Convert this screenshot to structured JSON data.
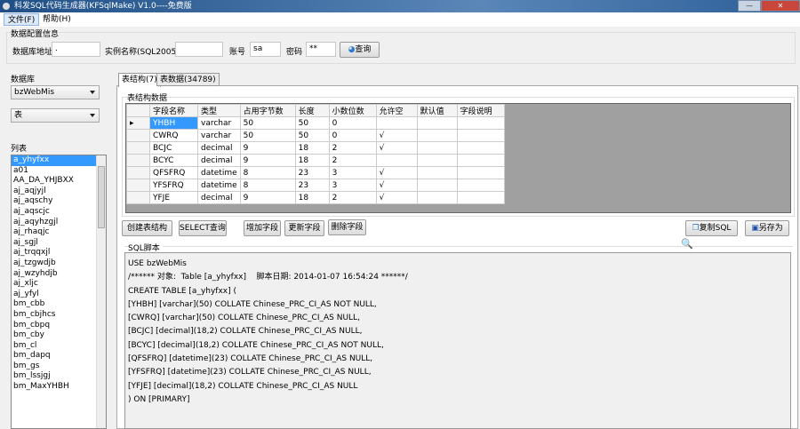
{
  "window": {
    "title": "科发SQL代码生成器(KFSqlMake) V1.0----免费版"
  },
  "menu": [
    "文件(F)",
    "帮助(H)"
  ],
  "config": {
    "group_label": "数据配置信息",
    "db_address_label": "数据库地址",
    "db_address_value": ".",
    "instance_label": "实例名称(SQL2005)",
    "instance_value": "",
    "account_label": "账号",
    "account_value": "sa",
    "password_label": "密码",
    "password_value": "**",
    "query_button": "查询"
  },
  "sidebar": {
    "database_label": "数据库",
    "database_value": "bzWebMis",
    "type_value": "表",
    "list_label": "列表",
    "items": [
      "a_yhyfxx",
      "a01",
      "AA_DA_YHJBXX",
      "aj_aqjyjl",
      "aj_aqschy",
      "aj_aqscjc",
      "aj_aqyhzgjl",
      "aj_rhaqjc",
      "aj_sgjl",
      "aj_trqqxjl",
      "aj_tzgwdjb",
      "aj_wzyhdjb",
      "aj_xljc",
      "aj_yfyl",
      "bm_cbb",
      "bm_cbjhcs",
      "bm_cbpq",
      "bm_cby",
      "bm_cl",
      "bm_dapq",
      "bm_gs",
      "bm_lssjgj",
      "bm_MaxYHBH"
    ],
    "selected": "a_yhyfxx"
  },
  "tabs": [
    "表结构(7)",
    "表数据(34789)"
  ],
  "structure": {
    "group_label": "表结构数据",
    "columns": [
      "字段名称",
      "类型",
      "占用字节数",
      "长度",
      "小数位数",
      "允许空",
      "默认值",
      "字段说明"
    ],
    "rows": [
      [
        "YHBH",
        "varchar",
        "50",
        "50",
        "0",
        "",
        "",
        ""
      ],
      [
        "CWRQ",
        "varchar",
        "50",
        "50",
        "0",
        "√",
        "",
        ""
      ],
      [
        "BCJC",
        "decimal",
        "9",
        "18",
        "2",
        "√",
        "",
        ""
      ],
      [
        "BCYC",
        "decimal",
        "9",
        "18",
        "2",
        "",
        "",
        ""
      ],
      [
        "QFSFRQ",
        "datetime",
        "8",
        "23",
        "3",
        "√",
        "",
        ""
      ],
      [
        "YFSFRQ",
        "datetime",
        "8",
        "23",
        "3",
        "√",
        "",
        ""
      ],
      [
        "YFJE",
        "decimal",
        "9",
        "18",
        "2",
        "√",
        "",
        ""
      ]
    ]
  },
  "buttons": {
    "create": "创建表结构",
    "select": "SELECT查询",
    "add": "增加字段",
    "update": "更新字段",
    "delete": "删除字段",
    "copy": "复制SQL",
    "save_as": "另存为"
  },
  "sql": {
    "label": "SQL脚本",
    "lines": [
      "USE bzWebMis",
      "/****** 对象:  Table [a_yhyfxx]    脚本日期: 2014-01-07 16:54:24 ******/",
      "CREATE TABLE [a_yhyfxx] (",
      "[YHBH] [varchar](50) COLLATE Chinese_PRC_CI_AS NOT NULL,",
      "[CWRQ] [varchar](50) COLLATE Chinese_PRC_CI_AS NULL,",
      "[BCJC] [decimal](18,2) COLLATE Chinese_PRC_CI_AS NULL,",
      "[BCYC] [decimal](18,2) COLLATE Chinese_PRC_CI_AS NOT NULL,",
      "[QFSFRQ] [datetime](23) COLLATE Chinese_PRC_CI_AS NULL,",
      "[YFSFRQ] [datetime](23) COLLATE Chinese_PRC_CI_AS NULL,",
      "[YFJE] [decimal](18,2) COLLATE Chinese_PRC_CI_AS NULL",
      ") ON [PRIMARY]"
    ]
  }
}
